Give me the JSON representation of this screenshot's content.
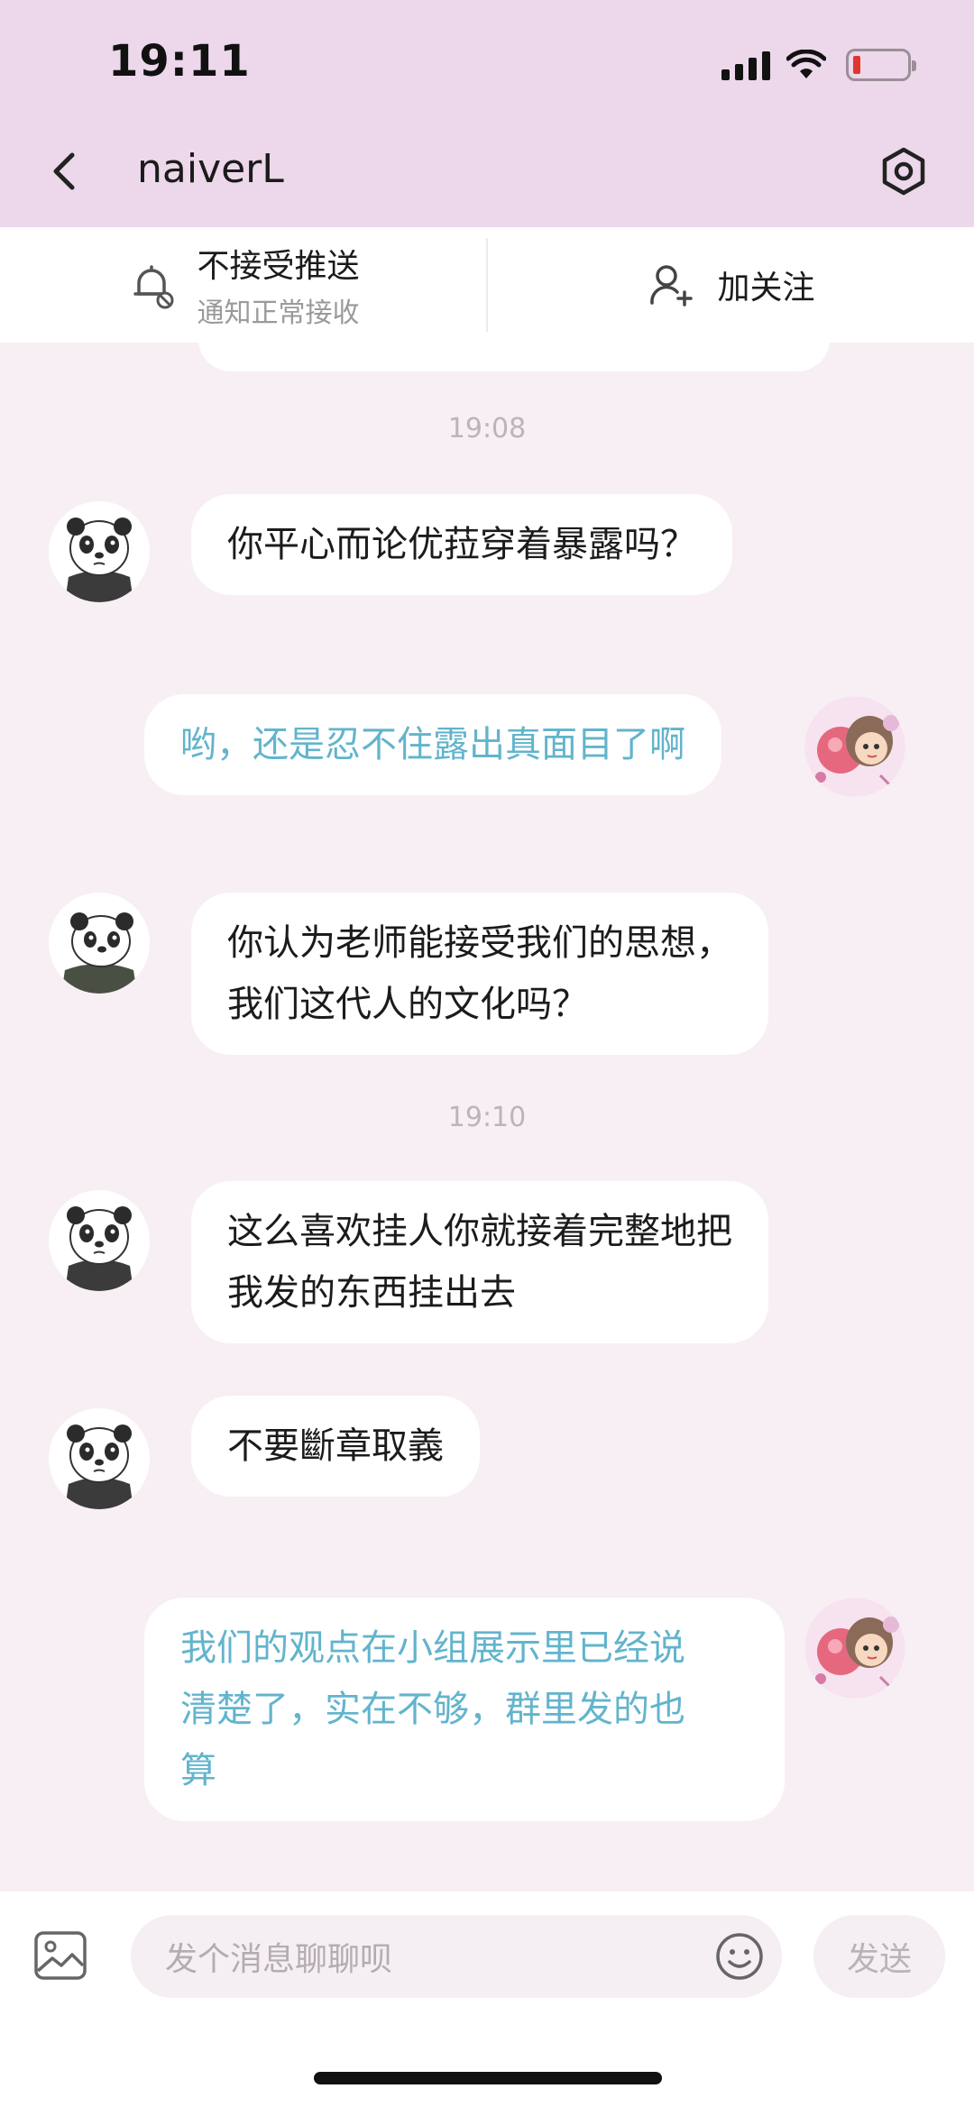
{
  "status_bar": {
    "time": "19:11"
  },
  "nav": {
    "title": "naiverL"
  },
  "actions": {
    "push": {
      "label": "不接受推送",
      "sub": "通知正常接收"
    },
    "follow": {
      "label": "加关注"
    }
  },
  "messages": [
    {
      "type": "time",
      "text": "19:08"
    },
    {
      "type": "msg",
      "side": "left",
      "lines": [
        "你平心而论优菈穿着暴露吗？"
      ]
    },
    {
      "type": "msg",
      "side": "right",
      "lines": [
        "哟，还是忍不住露出真面目了啊"
      ]
    },
    {
      "type": "msg",
      "side": "left",
      "lines": [
        "你认为老师能接受我们的思想，",
        "我们这代人的文化吗？"
      ]
    },
    {
      "type": "time",
      "text": "19:10"
    },
    {
      "type": "msg",
      "side": "left",
      "lines": [
        "这么喜欢挂人你就接着完整地把",
        "我发的东西挂出去"
      ]
    },
    {
      "type": "msg",
      "side": "left",
      "lines": [
        "不要斷章取義"
      ]
    },
    {
      "type": "msg",
      "side": "right",
      "lines": [
        "我们的观点在小组展示里已经说",
        "清楚了，实在不够，群里发的也",
        "算"
      ]
    }
  ],
  "input": {
    "placeholder": "发个消息聊聊呗",
    "send_label": "发送"
  },
  "colors": {
    "header_bg": "#ecd8ea",
    "chat_bg": "#f7eff4",
    "own_text": "#62b4cc"
  },
  "icons": [
    "back-arrow-icon",
    "hexagon-settings-icon",
    "bell-muted-icon",
    "add-user-icon",
    "image-icon",
    "emoji-icon",
    "panda-avatar",
    "anime-girl-avatar"
  ]
}
